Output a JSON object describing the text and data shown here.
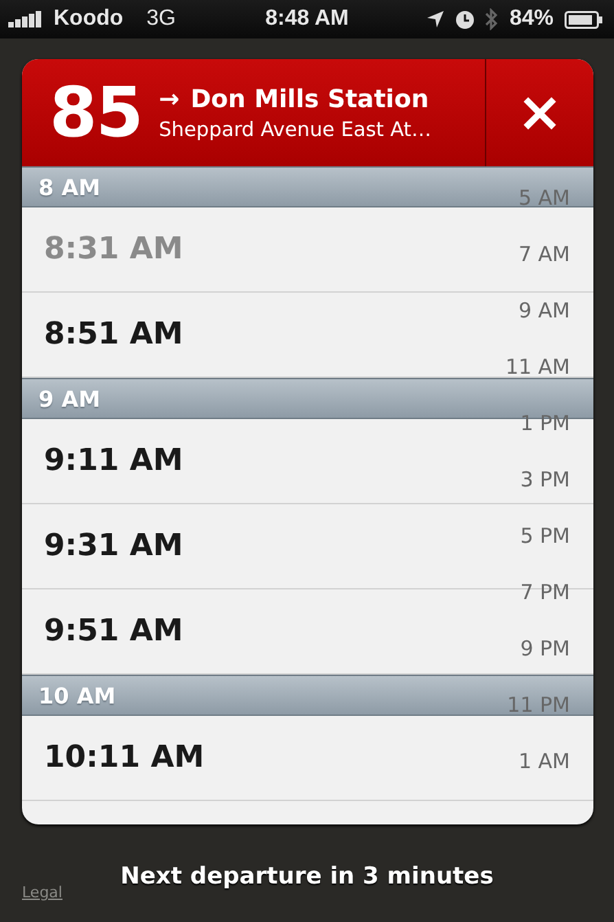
{
  "status_bar": {
    "carrier": "Koodo",
    "network": "3G",
    "time": "8:48 AM",
    "battery": "84%"
  },
  "route": {
    "number": "85",
    "arrow": "→",
    "destination": "Don Mills Station",
    "stop": "Sheppard Avenue East At…",
    "close": "×"
  },
  "schedule": [
    {
      "hour": "8 AM",
      "departures": [
        {
          "time": "8:31 AM",
          "departed": true
        },
        {
          "time": "8:51 AM",
          "departed": false
        }
      ]
    },
    {
      "hour": "9 AM",
      "departures": [
        {
          "time": "9:11 AM",
          "departed": false
        },
        {
          "time": "9:31 AM",
          "departed": false
        },
        {
          "time": "9:51 AM",
          "departed": false
        }
      ]
    },
    {
      "hour": "10 AM",
      "departures": [
        {
          "time": "10:11 AM",
          "departed": false
        }
      ]
    }
  ],
  "hour_index": [
    "5 AM",
    "7 AM",
    "9 AM",
    "11 AM",
    "1 PM",
    "3 PM",
    "5 PM",
    "7 PM",
    "9 PM",
    "11 PM",
    "1 AM"
  ],
  "footer": {
    "legal": "Legal",
    "message": "Next departure in 3 minutes"
  }
}
